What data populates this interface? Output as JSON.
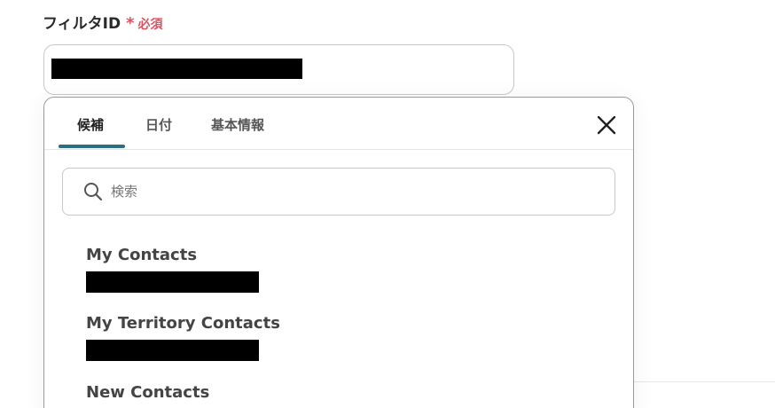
{
  "field": {
    "label": "フィルタID",
    "required_star": "*",
    "required_text": "必須"
  },
  "popup": {
    "tabs": [
      {
        "label": "候補",
        "active": true
      },
      {
        "label": "日付",
        "active": false
      },
      {
        "label": "基本情報",
        "active": false
      }
    ],
    "close_icon": "close-icon",
    "search": {
      "placeholder": "検索",
      "value": ""
    },
    "options": [
      {
        "title": "My Contacts"
      },
      {
        "title": "My Territory Contacts"
      },
      {
        "title": "New Contacts"
      }
    ]
  },
  "colors": {
    "required": "#e0505f",
    "tab_underline": "#2d6e83",
    "text": "#444444"
  }
}
